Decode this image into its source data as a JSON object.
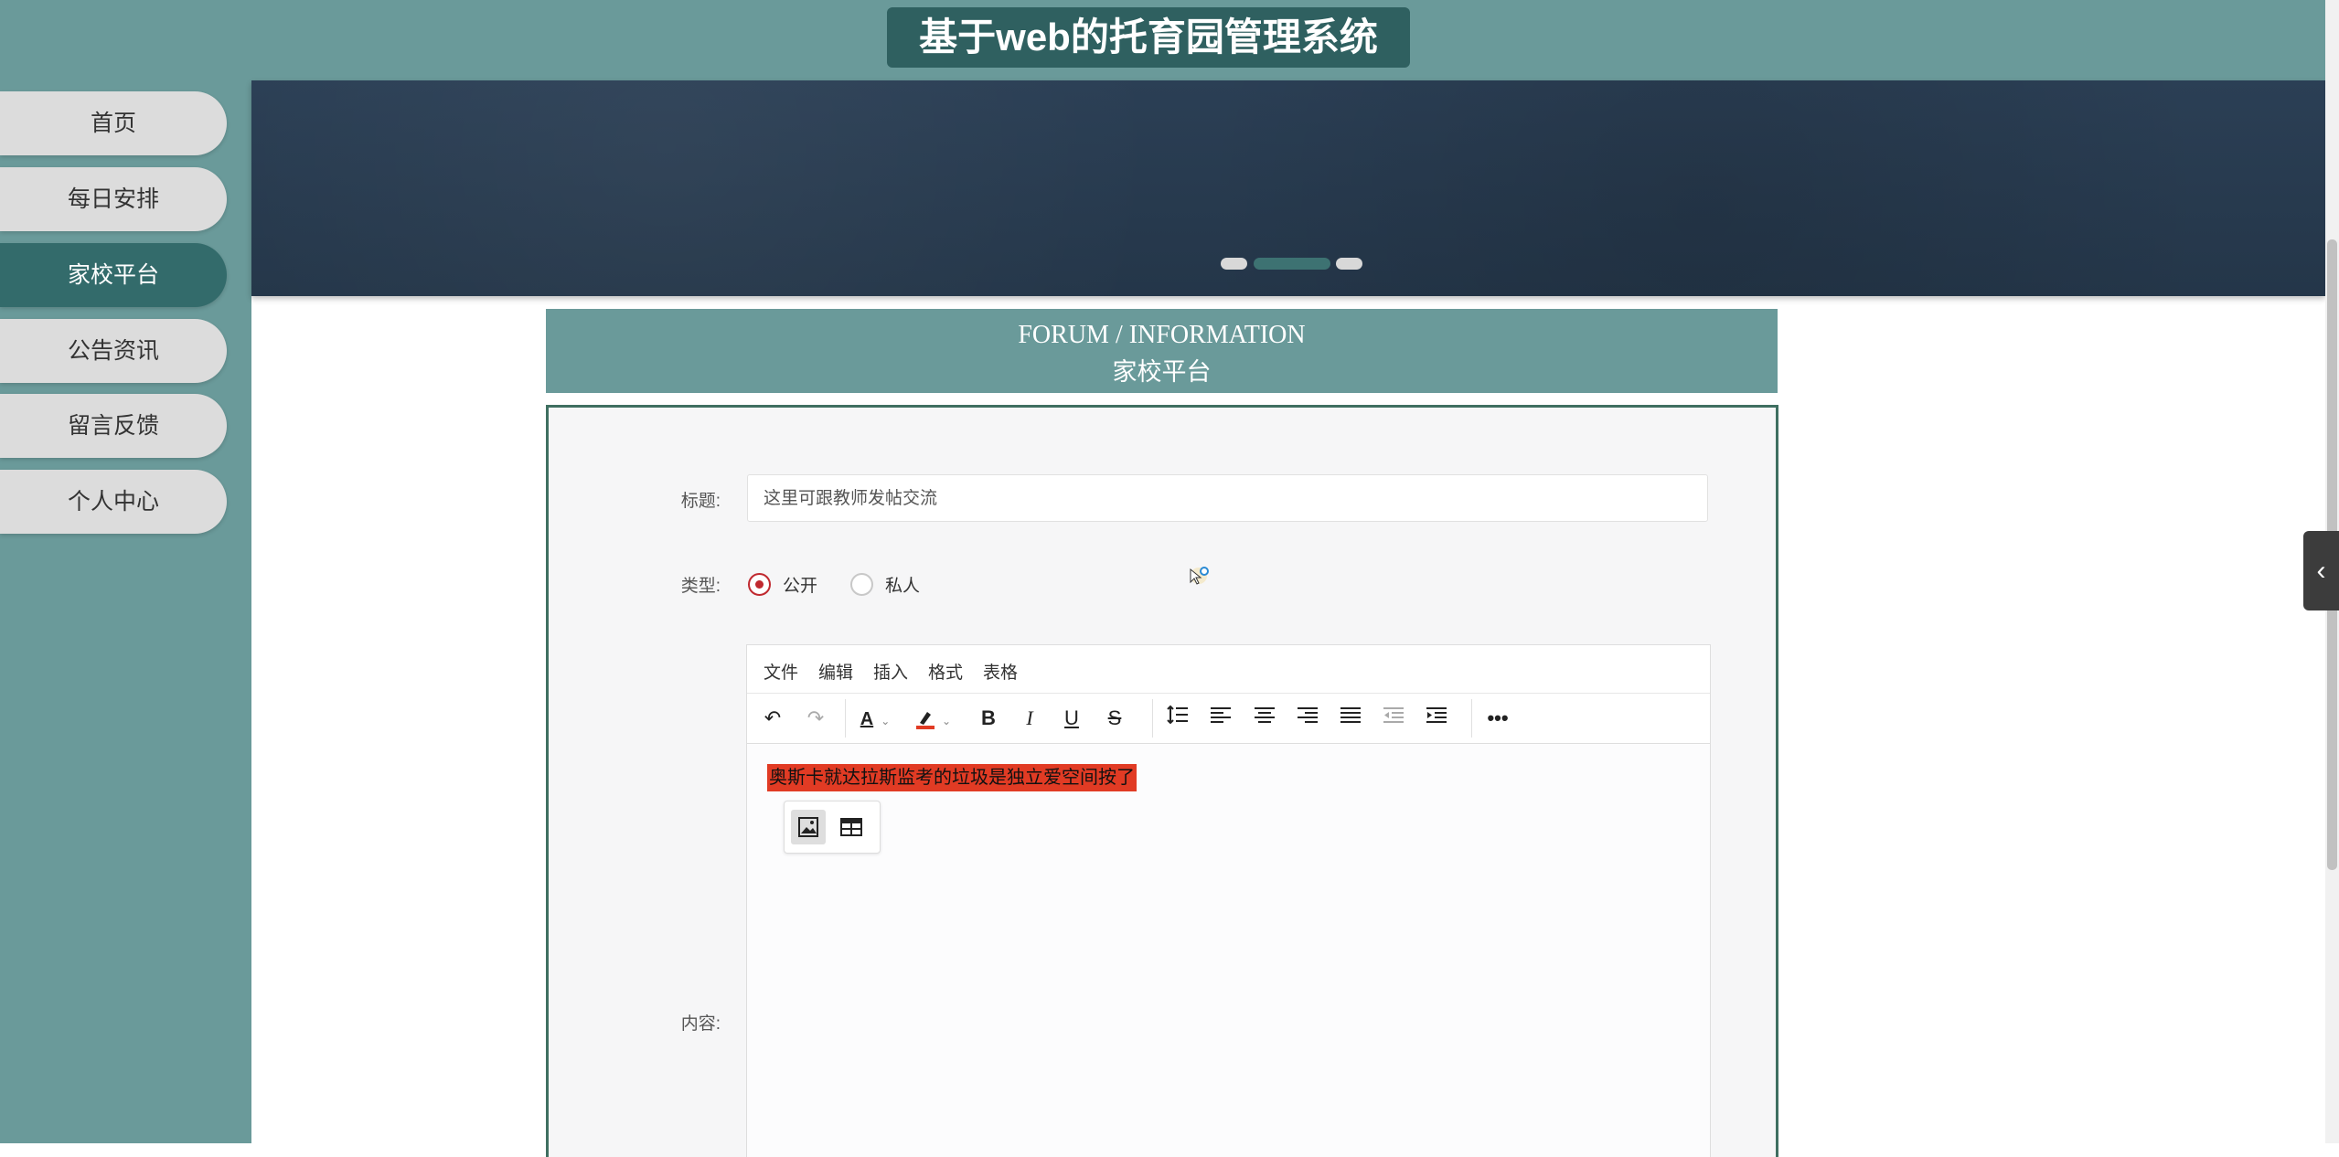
{
  "header": {
    "title": "基于web的托育园管理系统"
  },
  "sidebar": {
    "items": [
      {
        "label": "首页",
        "active": false
      },
      {
        "label": "每日安排",
        "active": false
      },
      {
        "label": "家校平台",
        "active": true
      },
      {
        "label": "公告资讯",
        "active": false
      },
      {
        "label": "留言反馈",
        "active": false
      },
      {
        "label": "个人中心",
        "active": false
      }
    ]
  },
  "banner": {
    "slide_count": 3,
    "active_slide": 2
  },
  "section": {
    "title_en": "FORUM / INFORMATION",
    "title_cn": "家校平台"
  },
  "form": {
    "title_label": "标题:",
    "title_value": "这里可跟教师发帖交流",
    "type_label": "类型:",
    "type_options": [
      {
        "label": "公开",
        "checked": true
      },
      {
        "label": "私人",
        "checked": false
      }
    ],
    "content_label": "内容:"
  },
  "editor": {
    "menus": [
      "文件",
      "编辑",
      "插入",
      "格式",
      "表格"
    ],
    "toolbar_icons": [
      "undo-icon",
      "redo-icon",
      "text-color-icon",
      "highlight-icon",
      "bold-icon",
      "italic-icon",
      "underline-icon",
      "strikethrough-icon",
      "line-height-icon",
      "align-left-icon",
      "align-center-icon",
      "align-right-icon",
      "justify-icon",
      "outdent-icon",
      "indent-icon",
      "more-icon"
    ],
    "content_text": "奥斯卡就达拉斯监考的垃圾是独立爱空间按了",
    "highlight_color": "#e13b24",
    "quick_insert": [
      "image-icon",
      "table-icon"
    ]
  },
  "colors": {
    "primary": "#6a9a9a",
    "dark": "#2f6060",
    "radio_active": "#c0292f"
  }
}
